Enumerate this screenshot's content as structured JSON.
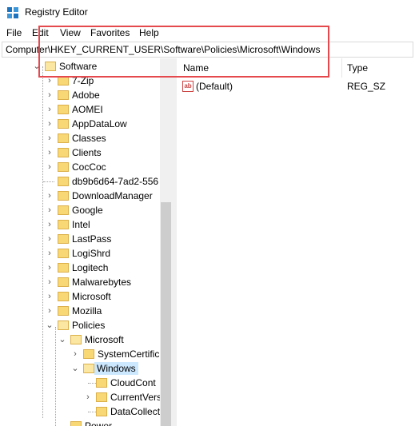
{
  "window": {
    "title": "Registry Editor"
  },
  "menu": [
    "File",
    "Edit",
    "View",
    "Favorites",
    "Help"
  ],
  "address": "Computer\\HKEY_CURRENT_USER\\Software\\Policies\\Microsoft\\Windows",
  "tree": {
    "software": "Software",
    "children": [
      "7-Zip",
      "Adobe",
      "AOMEI",
      "AppDataLow",
      "Classes",
      "Clients",
      "CocCoc",
      "db9b6d64-7ad2-556",
      "DownloadManager",
      "Google",
      "Intel",
      "LastPass",
      "LogiShrd",
      "Logitech",
      "Malwarebytes",
      "Microsoft",
      "Mozilla",
      "Policies"
    ],
    "policies_children": [
      "Microsoft"
    ],
    "microsoft_children": [
      "SystemCertific",
      "Windows"
    ],
    "windows_children": [
      "CloudCont",
      "CurrentVers",
      "DataCollect"
    ],
    "after": "Power"
  },
  "list": {
    "headers": [
      "Name",
      "Type"
    ],
    "rows": [
      {
        "name": "(Default)",
        "type": "REG_SZ"
      }
    ]
  },
  "colors": {
    "accent": "#e5484d",
    "selection": "#cce8ff",
    "folder": "#f8d775"
  }
}
